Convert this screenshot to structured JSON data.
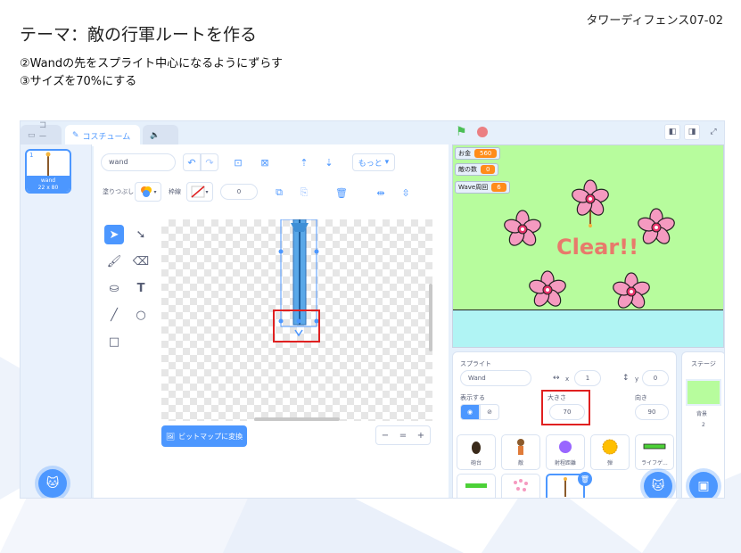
{
  "slide": {
    "title": "テーマ：敵の行軍ルートを作る",
    "tag": "タワーディフェンス07-02",
    "step1": "②Wandの先をスプライト中心になるようにずらす",
    "step2": "③サイズを70%にする"
  },
  "tabs": {
    "code": "コード",
    "costume": "コスチューム",
    "sound": ""
  },
  "costume": {
    "number": "1",
    "name": "wand",
    "size": "22 x 80"
  },
  "editor": {
    "name_value": "wand",
    "fill_label": "塗りつぶし",
    "outline_label": "枠線",
    "outline_width": "0",
    "more_label": "もっと",
    "convert_label": "ビットマップに変換",
    "zoom_out": "−",
    "zoom_reset": "=",
    "zoom_in": "+"
  },
  "stage": {
    "monitors": [
      {
        "label": "お金",
        "value": "560"
      },
      {
        "label": "敵の数",
        "value": "0"
      },
      {
        "label": "Wave周回",
        "value": "6"
      }
    ],
    "clear_text": "Clear!!"
  },
  "sprite_panel": {
    "sprite_label": "スプライト",
    "sprite_name": "Wand",
    "x_label": "x",
    "x_value": "1",
    "y_label": "y",
    "y_value": "0",
    "show_label": "表示する",
    "size_label": "大きさ",
    "size_value": "70",
    "direction_label": "向き",
    "direction_value": "90",
    "sprites": [
      {
        "name": "砲台"
      },
      {
        "name": "敵"
      },
      {
        "name": "射程距離"
      },
      {
        "name": "弾"
      },
      {
        "name": "ライフゲ..."
      },
      {
        "name": ""
      },
      {
        "name": ""
      },
      {
        "name": ""
      }
    ]
  },
  "stage_panel": {
    "title": "ステージ",
    "backdrop_label": "背景",
    "backdrop_count": "2"
  },
  "colors": {
    "accent": "#4c97ff",
    "stage_bg": "#b7fc9d",
    "water": "#b0f4f4",
    "monitor_value": "#ff8c1a",
    "highlight": "#e02020"
  }
}
